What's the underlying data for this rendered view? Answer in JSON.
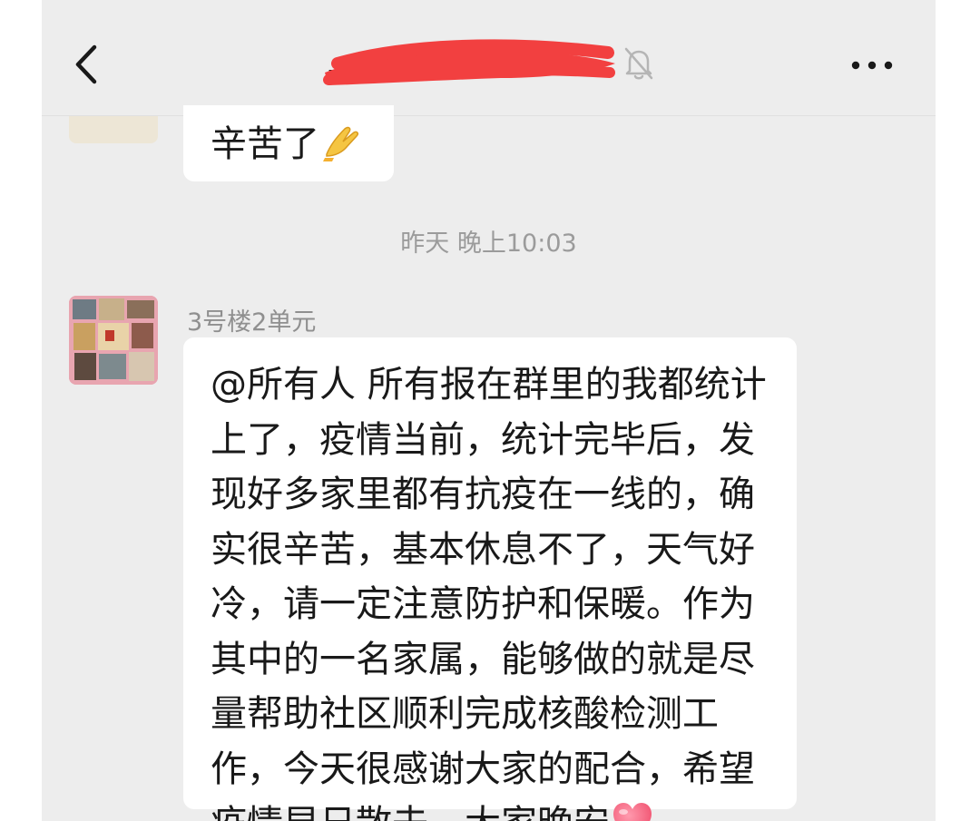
{
  "header": {
    "title": "…",
    "back_icon": "chevron-left-icon",
    "mute_icon": "bell-muted-icon",
    "more_icon": "more-dots-icon"
  },
  "messages": [
    {
      "text": "辛苦了",
      "emoji": "pray-icon"
    },
    {
      "timestamp": "昨天 晚上10:03"
    },
    {
      "sender": "3号楼2单元",
      "lines": [
        "@所有人 所有报在群里的我都统计",
        "上了，疫情当前，统计完毕后，发",
        "现好多家里都有抗疫在一线的，确",
        "实很辛苦，基本休息不了，天气好",
        "冷，请一定注意防护和保暖。作为",
        "其中的一名家属，能够做的就是尽",
        "量帮助社区顺利完成核酸检测工",
        "作，今天很感谢大家的配合，希望",
        "疫情早日散去，大家晚安"
      ],
      "emoji": "heart-icon"
    }
  ],
  "colors": {
    "background": "#ededed",
    "bubble": "#ffffff",
    "redaction": "#f24040",
    "text": "#191919",
    "meta_text": "#9b9b9b"
  }
}
